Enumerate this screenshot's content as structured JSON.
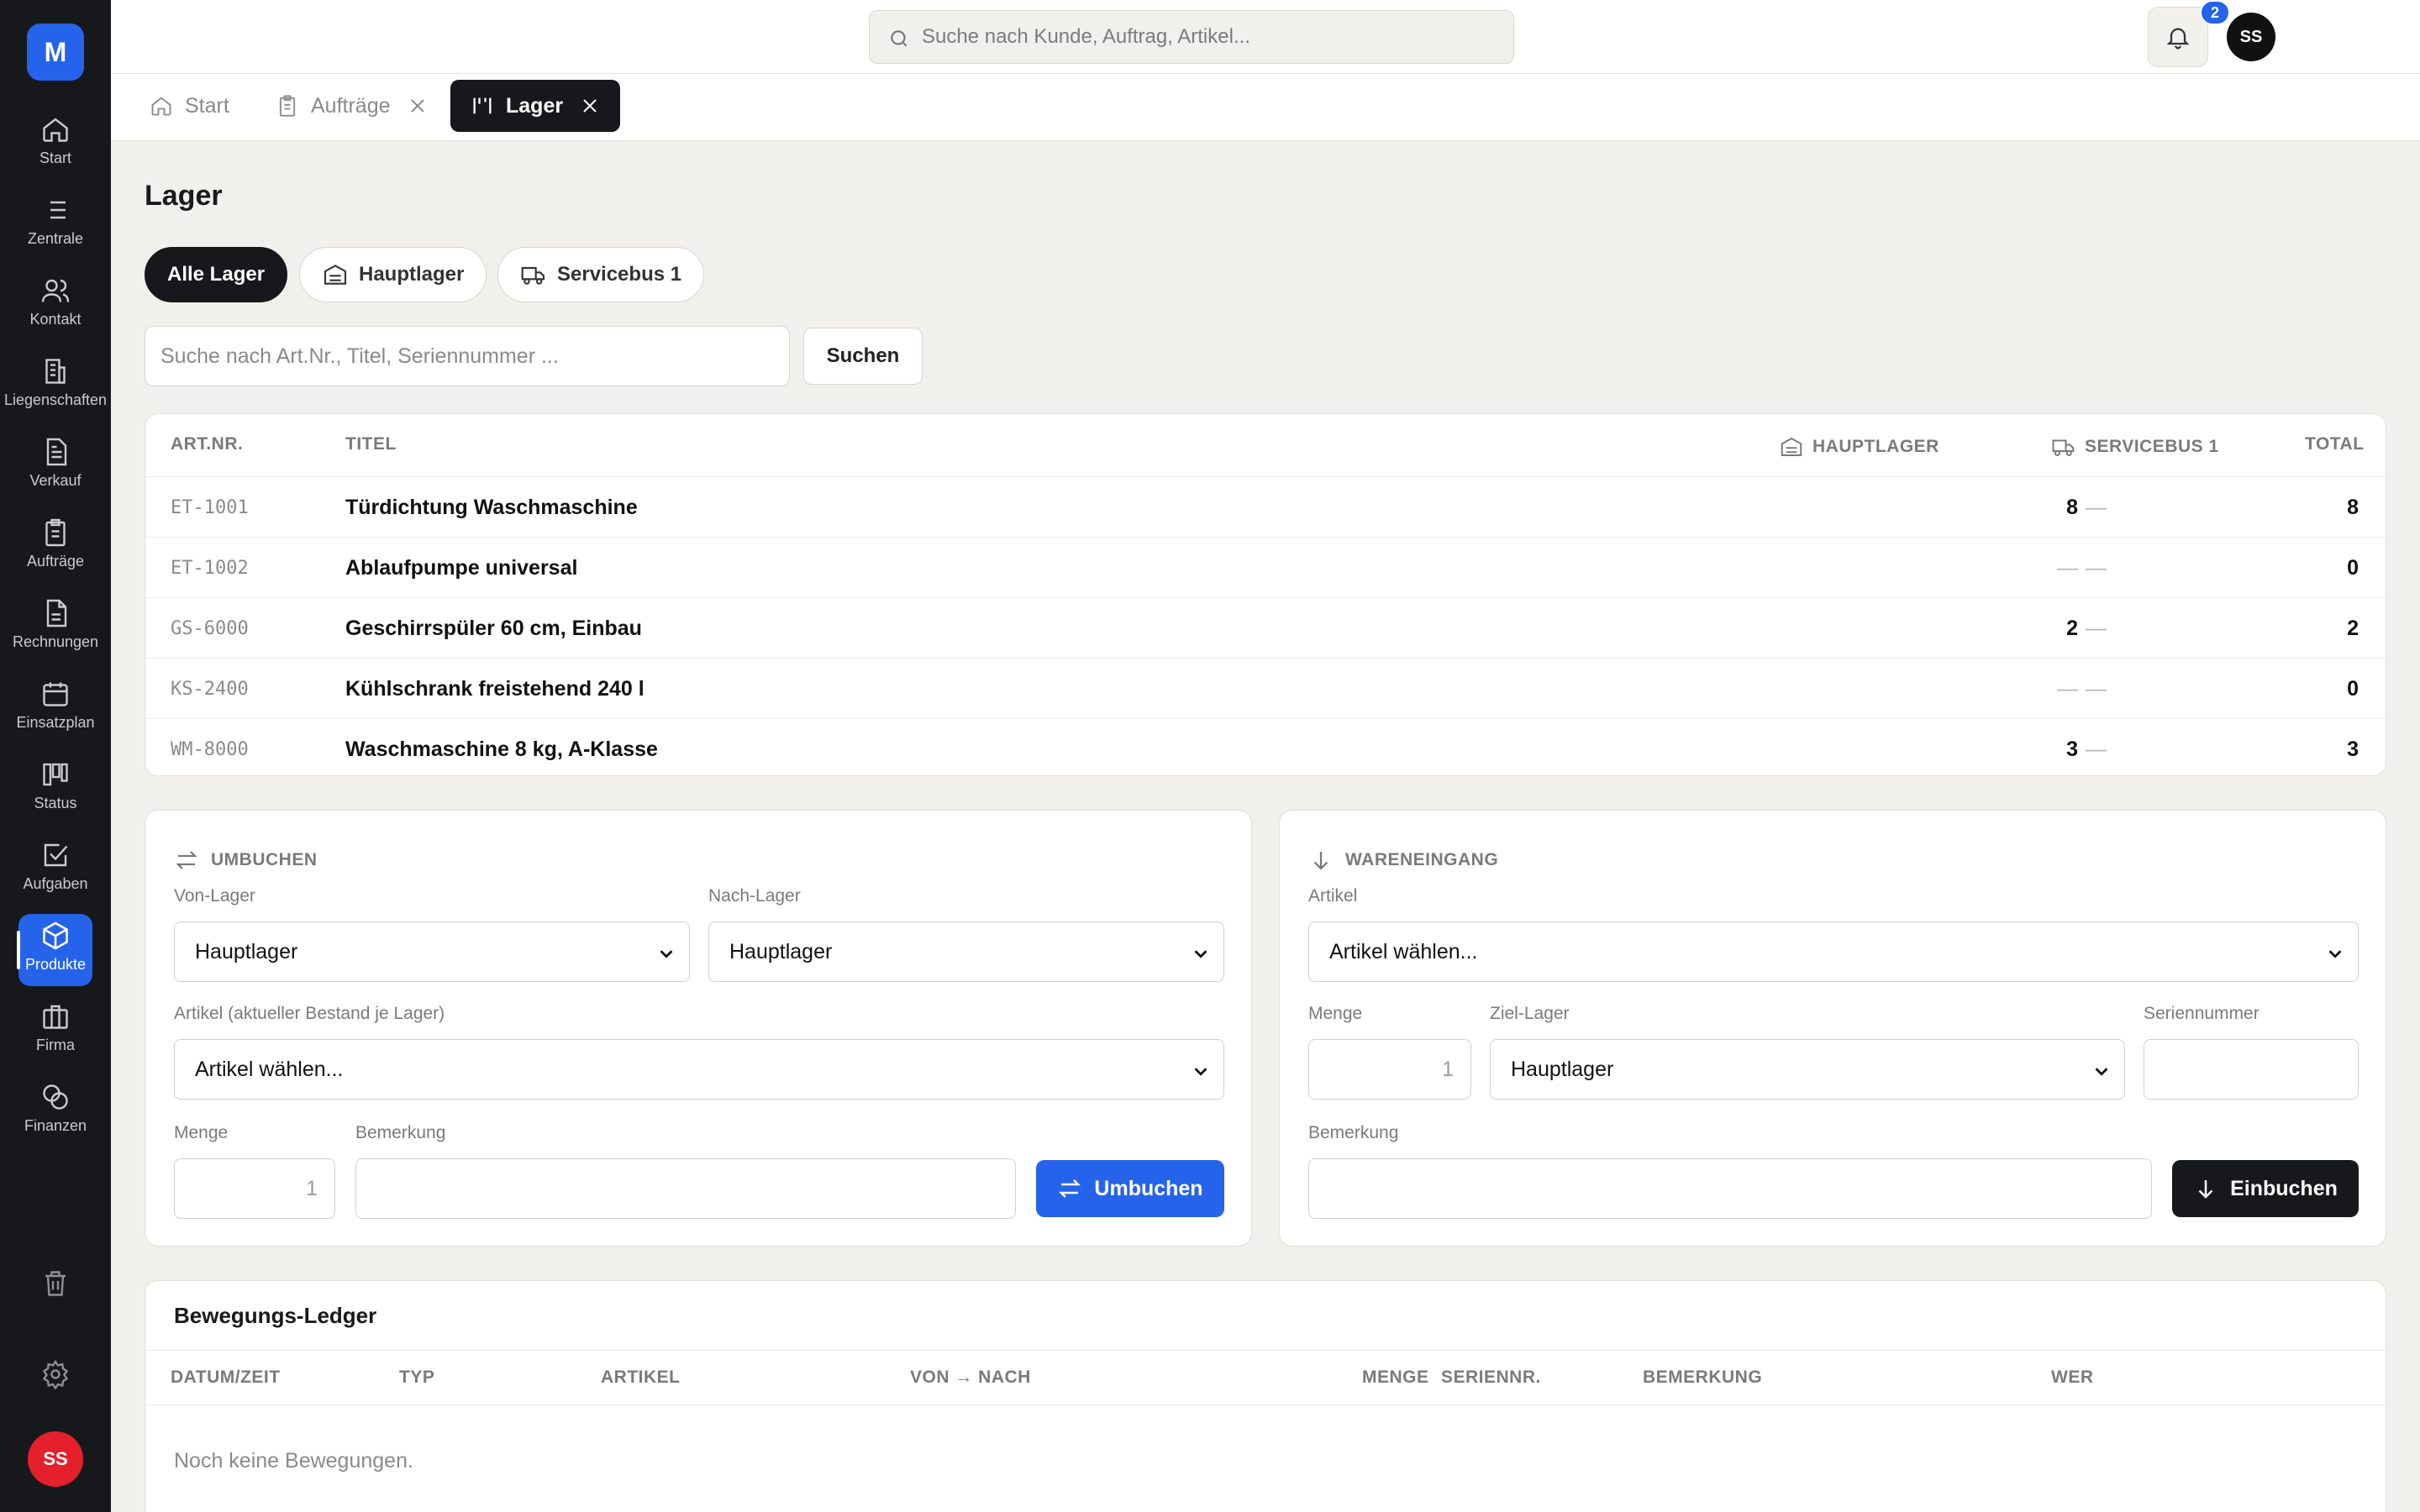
{
  "app": {
    "logo_letter": "M",
    "accent_color": "#2663eb",
    "dark_color": "#17181b"
  },
  "sidebar": {
    "items": [
      {
        "label": "Start",
        "icon": "home-icon"
      },
      {
        "label": "Zentrale",
        "icon": "list-icon"
      },
      {
        "label": "Kontakt",
        "icon": "users-icon"
      },
      {
        "label": "Liegenschaften",
        "icon": "building-icon"
      },
      {
        "label": "Verkauf",
        "icon": "document-icon"
      },
      {
        "label": "Aufträge",
        "icon": "clipboard-icon"
      },
      {
        "label": "Rechnungen",
        "icon": "invoice-icon"
      },
      {
        "label": "Einsatzplan",
        "icon": "calendar-icon"
      },
      {
        "label": "Status",
        "icon": "kanban-icon"
      },
      {
        "label": "Aufgaben",
        "icon": "checkbox-icon"
      },
      {
        "label": "Produkte",
        "icon": "box-icon",
        "active": true
      },
      {
        "label": "Firma",
        "icon": "briefcase-icon"
      },
      {
        "label": "Finanzen",
        "icon": "coins-icon"
      }
    ],
    "user_initials": "SS"
  },
  "topbar": {
    "search_placeholder": "Suche nach Kunde, Auftrag, Artikel...",
    "notification_count": "2",
    "user_initials": "SS"
  },
  "tabs": [
    {
      "label": "Start",
      "icon": "home-icon",
      "closable": false
    },
    {
      "label": "Aufträge",
      "icon": "clipboard-icon",
      "closable": true
    },
    {
      "label": "Lager",
      "icon": "warehouse-icon",
      "closable": true,
      "active": true
    }
  ],
  "page": {
    "title": "Lager",
    "filters": [
      {
        "label": "Alle Lager",
        "active": true
      },
      {
        "label": "Hauptlager",
        "icon": "warehouse-icon"
      },
      {
        "label": "Servicebus 1",
        "icon": "truck-icon"
      }
    ],
    "search_placeholder": "Suche nach Art.Nr., Titel, Seriennummer ...",
    "search_button": "Suchen"
  },
  "stock_table": {
    "headers": {
      "art_nr": "ART.NR.",
      "titel": "TITEL",
      "hauptlager": "HAUPTLAGER",
      "servicebus": "SERVICEBUS 1",
      "total": "TOTAL"
    },
    "rows": [
      {
        "art_nr": "ET-1001",
        "titel": "Türdichtung Waschmaschine",
        "hauptlager": "8",
        "servicebus": "—",
        "total": "8"
      },
      {
        "art_nr": "ET-1002",
        "titel": "Ablaufpumpe universal",
        "hauptlager": "—",
        "servicebus": "—",
        "total": "0"
      },
      {
        "art_nr": "GS-6000",
        "titel": "Geschirrspüler 60 cm, Einbau",
        "hauptlager": "2",
        "servicebus": "—",
        "total": "2"
      },
      {
        "art_nr": "KS-2400",
        "titel": "Kühlschrank freistehend 240 l",
        "hauptlager": "—",
        "servicebus": "—",
        "total": "0"
      },
      {
        "art_nr": "WM-8000",
        "titel": "Waschmaschine 8 kg, A-Klasse",
        "hauptlager": "3",
        "servicebus": "—",
        "total": "3"
      }
    ]
  },
  "umbuchen": {
    "title": "UMBUCHEN",
    "von_label": "Von-Lager",
    "von_value": "Hauptlager",
    "nach_label": "Nach-Lager",
    "nach_value": "Hauptlager",
    "artikel_label": "Artikel (aktueller Bestand je Lager)",
    "artikel_value": "Artikel wählen...",
    "menge_label": "Menge",
    "menge_value": "1",
    "bemerkung_label": "Bemerkung",
    "bemerkung_value": "",
    "button": "Umbuchen"
  },
  "wareneingang": {
    "title": "WARENEINGANG",
    "artikel_label": "Artikel",
    "artikel_value": "Artikel wählen...",
    "menge_label": "Menge",
    "menge_value": "1",
    "ziel_label": "Ziel-Lager",
    "ziel_value": "Hauptlager",
    "serien_label": "Seriennummer",
    "serien_value": "",
    "bemerkung_label": "Bemerkung",
    "bemerkung_value": "",
    "button": "Einbuchen"
  },
  "ledger": {
    "title": "Bewegungs-Ledger",
    "headers": {
      "datum": "DATUM/ZEIT",
      "typ": "TYP",
      "artikel": "ARTIKEL",
      "von_nach": "VON → NACH",
      "menge": "MENGE",
      "seriennr": "SERIENNR.",
      "bemerkung": "BEMERKUNG",
      "wer": "WER"
    },
    "empty_text": "Noch keine Bewegungen."
  }
}
